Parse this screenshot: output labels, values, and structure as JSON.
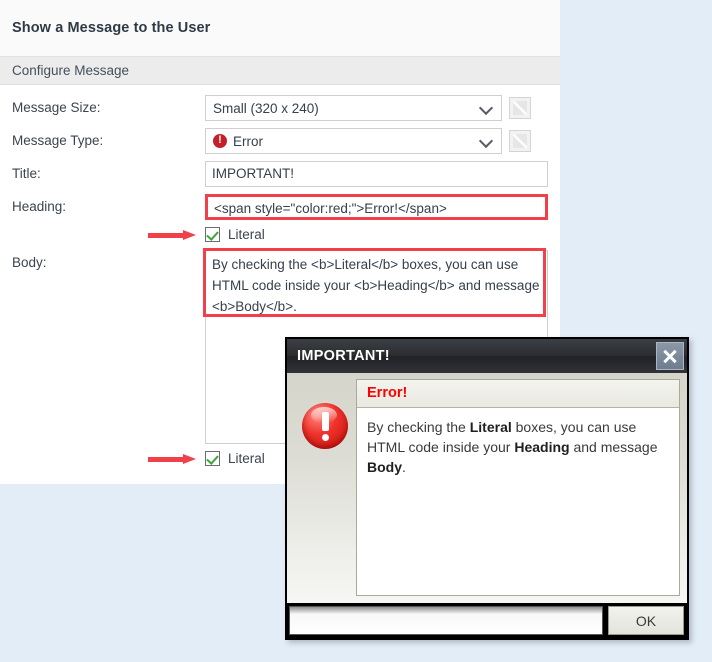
{
  "panel": {
    "title": "Show a Message to the User",
    "section_title": "Configure Message",
    "fields": {
      "message_size": {
        "label": "Message Size:",
        "value": "Small (320 x 240)",
        "control": "dropdown",
        "edit_button": "edit-pencil"
      },
      "message_type": {
        "label": "Message Type:",
        "value": "Error",
        "icon": "error-circle-icon",
        "control": "dropdown",
        "edit_button": "edit-pencil"
      },
      "title": {
        "label": "Title:",
        "value": "IMPORTANT!",
        "placeholder": ""
      },
      "heading": {
        "label": "Heading:",
        "value": "<span style=\"color:red;\">Error!</span>",
        "placeholder": "",
        "highlighted": true
      },
      "body": {
        "label": "Body:",
        "value": "By checking the <b>Literal</b> boxes, you can use HTML code inside your <b>Heading</b> and message <b>Body</b>.",
        "placeholder": "",
        "highlighted": true
      }
    },
    "heading_literal_checkbox": {
      "label": "Literal",
      "checked": true,
      "annotation": "red-arrow-pointer"
    },
    "body_literal_checkbox": {
      "label": "Literal",
      "checked": true,
      "annotation": "red-arrow-pointer"
    }
  },
  "dialog": {
    "title": "IMPORTANT!",
    "close_button": "close-x-icon",
    "icon": "error-exclamation-icon",
    "heading": "Error!",
    "message_parts": [
      {
        "text": "By checking the ",
        "bold": false
      },
      {
        "text": "Literal",
        "bold": true
      },
      {
        "text": " boxes, you can use HTML code inside your ",
        "bold": false
      },
      {
        "text": "Heading",
        "bold": true
      },
      {
        "text": " and message ",
        "bold": false
      },
      {
        "text": "Body",
        "bold": true
      },
      {
        "text": ".",
        "bold": false
      }
    ],
    "ok_button": "OK"
  },
  "colors": {
    "page_background": "#e3edf7",
    "panel_background": "#ffffff",
    "section_bar": "#ececec",
    "highlight_red": "#f2404a",
    "error_red": "#c5202a",
    "dialog_heading_red": "#ff0000",
    "checkbox_green": "#3aa63a",
    "dialog_titlebar": "#2b2d31"
  }
}
